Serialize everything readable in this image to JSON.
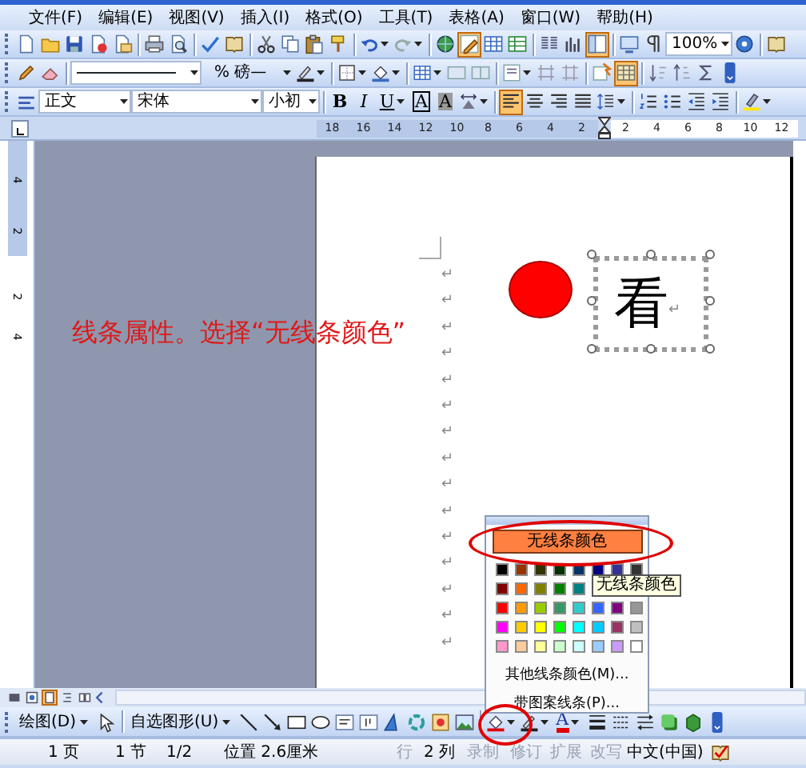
{
  "menu_bar": {
    "items": [
      {
        "label": "文件(F)"
      },
      {
        "label": "编辑(E)"
      },
      {
        "label": "视图(V)"
      },
      {
        "label": "插入(I)"
      },
      {
        "label": "格式(O)"
      },
      {
        "label": "工具(T)"
      },
      {
        "label": "表格(A)"
      },
      {
        "label": "窗口(W)"
      },
      {
        "label": "帮助(H)"
      }
    ]
  },
  "standard_toolbar": {
    "items": [
      {
        "kind": "button",
        "active": false
      },
      {
        "kind": "button",
        "active": false
      },
      {
        "kind": "button",
        "active": false
      },
      {
        "kind": "button",
        "active": false
      },
      {
        "kind": "button",
        "active": false
      },
      {
        "kind": "sep"
      },
      {
        "kind": "button",
        "active": false
      },
      {
        "kind": "button",
        "active": false
      },
      {
        "kind": "sep"
      },
      {
        "kind": "button",
        "active": false
      },
      {
        "kind": "button",
        "active": false
      },
      {
        "kind": "sep"
      },
      {
        "kind": "button",
        "active": false
      },
      {
        "kind": "button",
        "active": false
      },
      {
        "kind": "button",
        "active": false
      },
      {
        "kind": "button",
        "active": false
      },
      {
        "kind": "sep"
      },
      {
        "kind": "split",
        "active": false
      },
      {
        "kind": "split",
        "active": false
      },
      {
        "kind": "sep"
      },
      {
        "kind": "button",
        "active": false
      },
      {
        "kind": "button",
        "active": true
      },
      {
        "kind": "button",
        "active": false
      },
      {
        "kind": "button",
        "active": false
      },
      {
        "kind": "sep"
      },
      {
        "kind": "button",
        "active": false
      },
      {
        "kind": "button",
        "active": false
      },
      {
        "kind": "button",
        "active": true
      },
      {
        "kind": "sep"
      },
      {
        "kind": "button",
        "active": false
      },
      {
        "kind": "button",
        "active": false
      },
      {
        "kind": "field",
        "value": "100%"
      },
      {
        "kind": "button",
        "active": false
      },
      {
        "kind": "sep"
      },
      {
        "kind": "button",
        "active": false
      }
    ]
  },
  "tables_toolbar": {
    "items": [
      {
        "kind": "button",
        "active": false
      },
      {
        "kind": "button",
        "active": false
      },
      {
        "kind": "sep"
      },
      {
        "kind": "linefield"
      },
      {
        "kind": "field",
        "value": "% 磅—"
      },
      {
        "kind": "split",
        "active": false
      },
      {
        "kind": "sep"
      },
      {
        "kind": "split",
        "active": false
      },
      {
        "kind": "split",
        "active": false
      },
      {
        "kind": "sep"
      },
      {
        "kind": "split",
        "active": false
      },
      {
        "kind": "button",
        "active": false
      },
      {
        "kind": "button",
        "active": false
      },
      {
        "kind": "sep"
      },
      {
        "kind": "split",
        "active": false
      },
      {
        "kind": "button",
        "active": false
      },
      {
        "kind": "button",
        "active": false
      },
      {
        "kind": "sep"
      },
      {
        "kind": "button",
        "active": false
      },
      {
        "kind": "button",
        "active": true
      },
      {
        "kind": "sep"
      },
      {
        "kind": "button",
        "active": false
      },
      {
        "kind": "button",
        "active": false
      },
      {
        "kind": "button",
        "active": false
      },
      {
        "kind": "button",
        "active": false
      }
    ]
  },
  "formatting_toolbar": {
    "items": [
      {
        "kind": "button",
        "active": false
      },
      {
        "kind": "field",
        "value": "正文"
      },
      {
        "kind": "field",
        "value": "宋体"
      },
      {
        "kind": "field",
        "value": "小初"
      },
      {
        "kind": "sep"
      },
      {
        "kind": "text",
        "label": "B",
        "active": false
      },
      {
        "kind": "text",
        "label": "I",
        "active": false
      },
      {
        "kind": "textsplit",
        "label": "U",
        "active": false
      },
      {
        "kind": "text",
        "label": "A",
        "active": false
      },
      {
        "kind": "text",
        "label": "A",
        "active": false
      },
      {
        "kind": "split",
        "active": false
      },
      {
        "kind": "sep"
      },
      {
        "kind": "button",
        "active": true
      },
      {
        "kind": "button",
        "active": false
      },
      {
        "kind": "button",
        "active": false
      },
      {
        "kind": "button",
        "active": false
      },
      {
        "kind": "split",
        "active": false
      },
      {
        "kind": "sep"
      },
      {
        "kind": "button",
        "active": false
      },
      {
        "kind": "button",
        "active": false
      },
      {
        "kind": "button",
        "active": false
      },
      {
        "kind": "button",
        "active": false
      },
      {
        "kind": "sep"
      },
      {
        "kind": "split",
        "active": false
      }
    ]
  },
  "ruler": {
    "left_numbers": [
      "18",
      "16",
      "14",
      "12",
      "10",
      "8",
      "6",
      "4",
      "2"
    ],
    "right_numbers": [
      "2",
      "4",
      "6",
      "8",
      "10",
      "12"
    ]
  },
  "vertical_ruler": {
    "top_numbers": [
      "4",
      "2"
    ],
    "bottom_numbers": [
      "2",
      "4"
    ]
  },
  "annotation": {
    "text": "线条属性。选择“无线条颜色”"
  },
  "document": {
    "paragraph_marks": [
      "↵",
      "↵",
      "↵",
      "↵",
      "↵",
      "↵",
      "↵",
      "↵",
      "↵",
      "↵",
      "↵",
      "↵",
      "↵",
      "↵",
      "↵"
    ],
    "textbox": {
      "text": "看",
      "mark": "↵"
    }
  },
  "line_color_menu": {
    "no_line_button": "无线条颜色",
    "swatch_rows": [
      [
        {
          "color": "#000000"
        },
        {
          "color": "#993300"
        },
        {
          "color": "#333300"
        },
        {
          "color": "#003300"
        },
        {
          "color": "#003366"
        },
        {
          "color": "#000080"
        },
        {
          "color": "#333399"
        },
        {
          "color": "#333333"
        }
      ],
      [
        {
          "color": "#800000"
        },
        {
          "color": "#ff6600"
        },
        {
          "color": "#808000"
        },
        {
          "color": "#008000"
        },
        {
          "color": "#008080"
        }
      ],
      [
        {
          "color": "#ff0000"
        },
        {
          "color": "#ff9900"
        },
        {
          "color": "#99cc00"
        },
        {
          "color": "#339966"
        },
        {
          "color": "#33cccc"
        },
        {
          "color": "#3366ff"
        },
        {
          "color": "#800080"
        },
        {
          "color": "#969696"
        }
      ],
      [
        {
          "color": "#ff00ff"
        },
        {
          "color": "#ffcc00"
        },
        {
          "color": "#ffff00"
        },
        {
          "color": "#00ff00"
        },
        {
          "color": "#00ffff"
        },
        {
          "color": "#00ccff"
        },
        {
          "color": "#993366"
        },
        {
          "color": "#c0c0c0"
        }
      ],
      [
        {
          "color": "#ff99cc"
        },
        {
          "color": "#ffcc99"
        },
        {
          "color": "#ffff99"
        },
        {
          "color": "#ccffcc"
        },
        {
          "color": "#ccffff"
        },
        {
          "color": "#99ccff"
        },
        {
          "color": "#cc99ff"
        },
        {
          "color": "#ffffff"
        }
      ]
    ],
    "tooltip": "无线条颜色",
    "more_colors": "其他线条颜色(M)...",
    "patterned_lines": "带图案线条(P)..."
  },
  "view_buttons": [
    {
      "selected": false
    },
    {
      "selected": false
    },
    {
      "selected": true
    },
    {
      "selected": false
    },
    {
      "selected": false
    }
  ],
  "drawing_toolbar": {
    "items": [
      {
        "kind": "menu",
        "label": "绘图(D)"
      },
      {
        "kind": "button",
        "active": false
      },
      {
        "kind": "sep"
      },
      {
        "kind": "menu",
        "label": "自选图形(U)"
      },
      {
        "kind": "button",
        "active": false
      },
      {
        "kind": "button",
        "active": false
      },
      {
        "kind": "button",
        "active": false
      },
      {
        "kind": "button",
        "active": false
      },
      {
        "kind": "button",
        "active": false
      },
      {
        "kind": "button",
        "active": false
      },
      {
        "kind": "button",
        "active": false
      },
      {
        "kind": "button",
        "active": false
      },
      {
        "kind": "button",
        "active": false
      },
      {
        "kind": "button",
        "active": false
      },
      {
        "kind": "sep"
      },
      {
        "kind": "split",
        "active": false
      },
      {
        "kind": "split",
        "active": false
      },
      {
        "kind": "textsplit",
        "label": "A",
        "active": false
      },
      {
        "kind": "button",
        "active": false
      },
      {
        "kind": "button",
        "active": false
      },
      {
        "kind": "button",
        "active": false
      },
      {
        "kind": "button",
        "active": false
      },
      {
        "kind": "button",
        "active": false
      },
      {
        "kind": "button",
        "active": false
      }
    ]
  },
  "status_bar": {
    "items": [
      {
        "label": "1 页",
        "disabled": false
      },
      {
        "label": "1 节",
        "disabled": false
      },
      {
        "label": "1/2",
        "disabled": false
      },
      {
        "label": "位置 2.6厘米",
        "disabled": false
      },
      {
        "label": "行",
        "disabled": true
      },
      {
        "label": "2 列",
        "disabled": false
      },
      {
        "label": "录制",
        "disabled": true
      },
      {
        "label": "修订",
        "disabled": true
      },
      {
        "label": "扩展",
        "disabled": true
      },
      {
        "label": "改写",
        "disabled": true
      },
      {
        "label": "中文(中国)",
        "disabled": false
      }
    ]
  }
}
